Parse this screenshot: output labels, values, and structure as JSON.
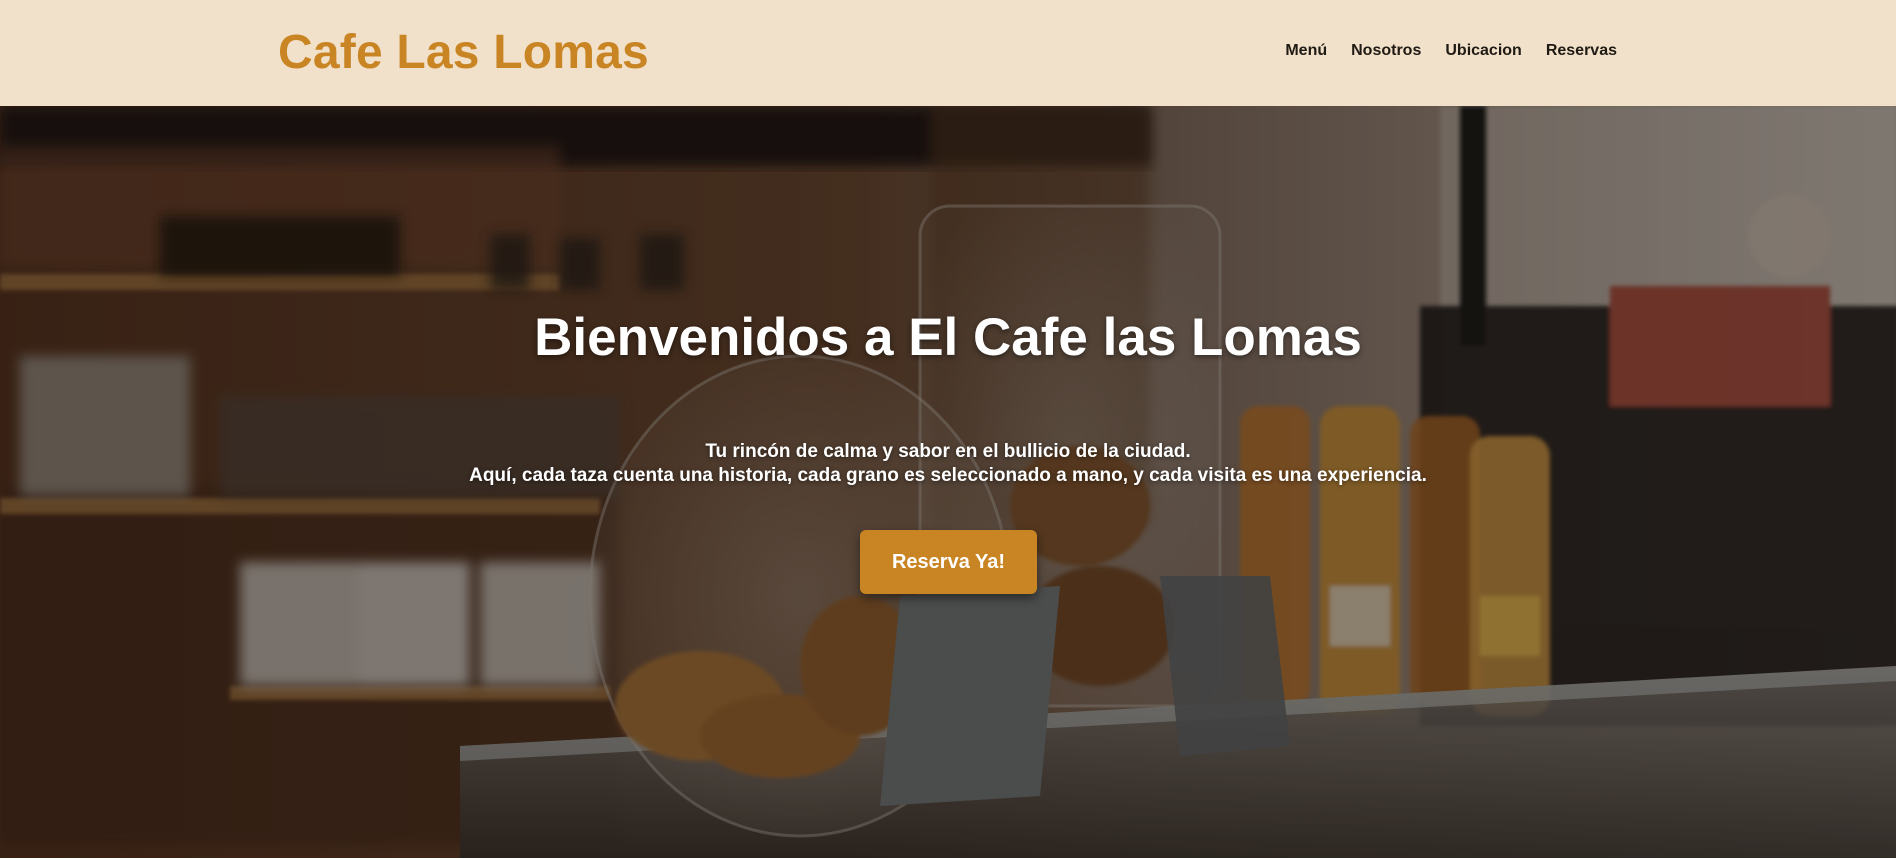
{
  "header": {
    "brand": "Cafe Las Lomas",
    "nav": [
      {
        "label": "Menú"
      },
      {
        "label": "Nosotros"
      },
      {
        "label": "Ubicacion"
      },
      {
        "label": "Reservas"
      }
    ]
  },
  "hero": {
    "title": "Bienvenidos a El Cafe las Lomas",
    "subtitle_line1": "Tu rincón de calma y sabor en el bullicio de la ciudad.",
    "subtitle_line2": "Aquí, cada taza cuenta una historia, cada grano es seleccionado a mano, y cada visita es una experiencia.",
    "cta_label": "Reserva Ya!",
    "background_image": "cafe-counter-photo"
  },
  "colors": {
    "header_bg": "#f2e1ca",
    "brand": "#c98524",
    "nav_text": "#1f1a14",
    "cta_bg": "#c98524",
    "hero_text": "#ffffff"
  }
}
